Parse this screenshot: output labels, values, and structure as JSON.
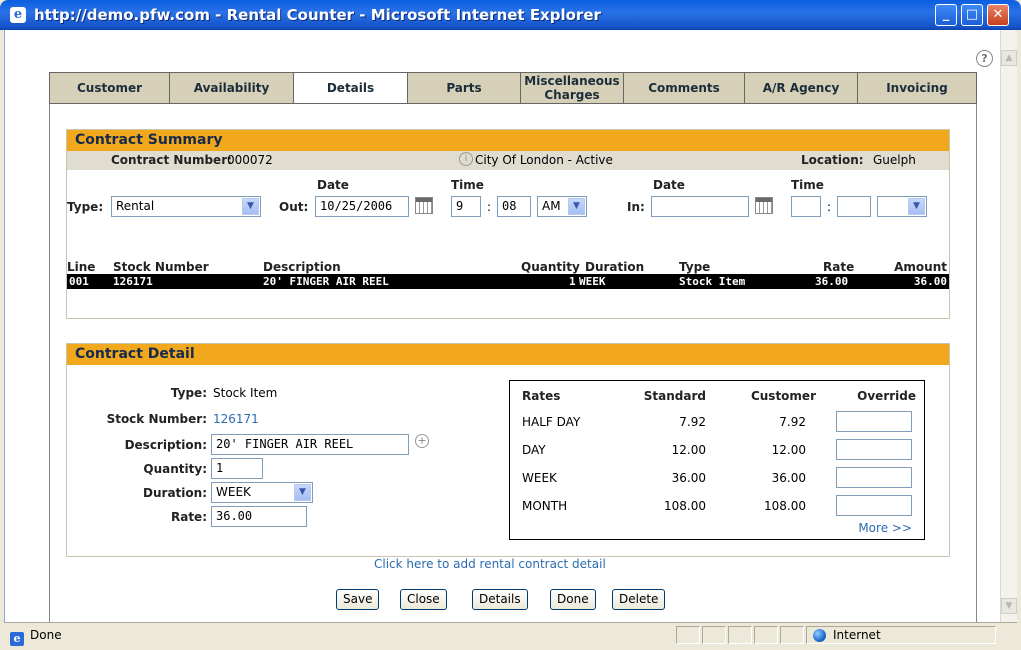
{
  "window": {
    "title": "http://demo.pfw.com - Rental Counter - Microsoft Internet Explorer"
  },
  "tabs": [
    "Customer",
    "Availability",
    "Details",
    "Parts",
    "Miscellaneous Charges",
    "Comments",
    "A/R Agency",
    "Invoicing"
  ],
  "active_tab": "Details",
  "summary": {
    "heading": "Contract Summary",
    "contract_number_label": "Contract Number:",
    "contract_number": "000072",
    "customer": "City Of London - Active",
    "location_label": "Location:",
    "location": "Guelph",
    "type_label": "Type:",
    "type_value": "Rental",
    "date_label_out": "Date",
    "time_label_out": "Time",
    "out_label": "Out:",
    "out_date": "10/25/2006",
    "out_hour": "9",
    "out_minute": "08",
    "out_ampm": "AM",
    "time_sep": ":",
    "date_label_in": "Date",
    "time_label_in": "Time",
    "in_label": "In:",
    "in_date": "",
    "in_hour": "",
    "in_minute": "",
    "in_ampm": ""
  },
  "lines_table": {
    "headers": {
      "line": "Line",
      "stock": "Stock Number",
      "desc": "Description",
      "qty": "Quantity",
      "duration": "Duration",
      "type": "Type",
      "rate": "Rate",
      "amount": "Amount"
    },
    "rows": [
      {
        "line": "001",
        "stock": "126171",
        "desc": "20' FINGER AIR REEL",
        "qty": "1",
        "duration": "WEEK",
        "type": "Stock Item",
        "rate": "36.00",
        "amount": "36.00"
      }
    ]
  },
  "detail": {
    "heading": "Contract Detail",
    "type_label": "Type:",
    "type_value": "Stock Item",
    "stock_label": "Stock Number:",
    "stock_value": "126171",
    "desc_label": "Description:",
    "desc_value": "20' FINGER AIR REEL",
    "qty_label": "Quantity:",
    "qty_value": "1",
    "duration_label": "Duration:",
    "duration_value": "WEEK",
    "rate_label": "Rate:",
    "rate_value": "36.00"
  },
  "rates": {
    "headers": {
      "rates": "Rates",
      "standard": "Standard",
      "customer": "Customer",
      "override": "Override"
    },
    "rows": [
      {
        "name": "HALF DAY",
        "standard": "7.92",
        "customer": "7.92",
        "override": ""
      },
      {
        "name": "DAY",
        "standard": "12.00",
        "customer": "12.00",
        "override": ""
      },
      {
        "name": "WEEK",
        "standard": "36.00",
        "customer": "36.00",
        "override": ""
      },
      {
        "name": "MONTH",
        "standard": "108.00",
        "customer": "108.00",
        "override": ""
      }
    ],
    "more_link": "More >>"
  },
  "add_detail_link": "Click here to add rental contract detail",
  "buttons": {
    "save": "Save",
    "close": "Close",
    "details": "Details",
    "done": "Done",
    "delete": "Delete"
  },
  "status": {
    "text": "Done",
    "zone": "Internet"
  }
}
